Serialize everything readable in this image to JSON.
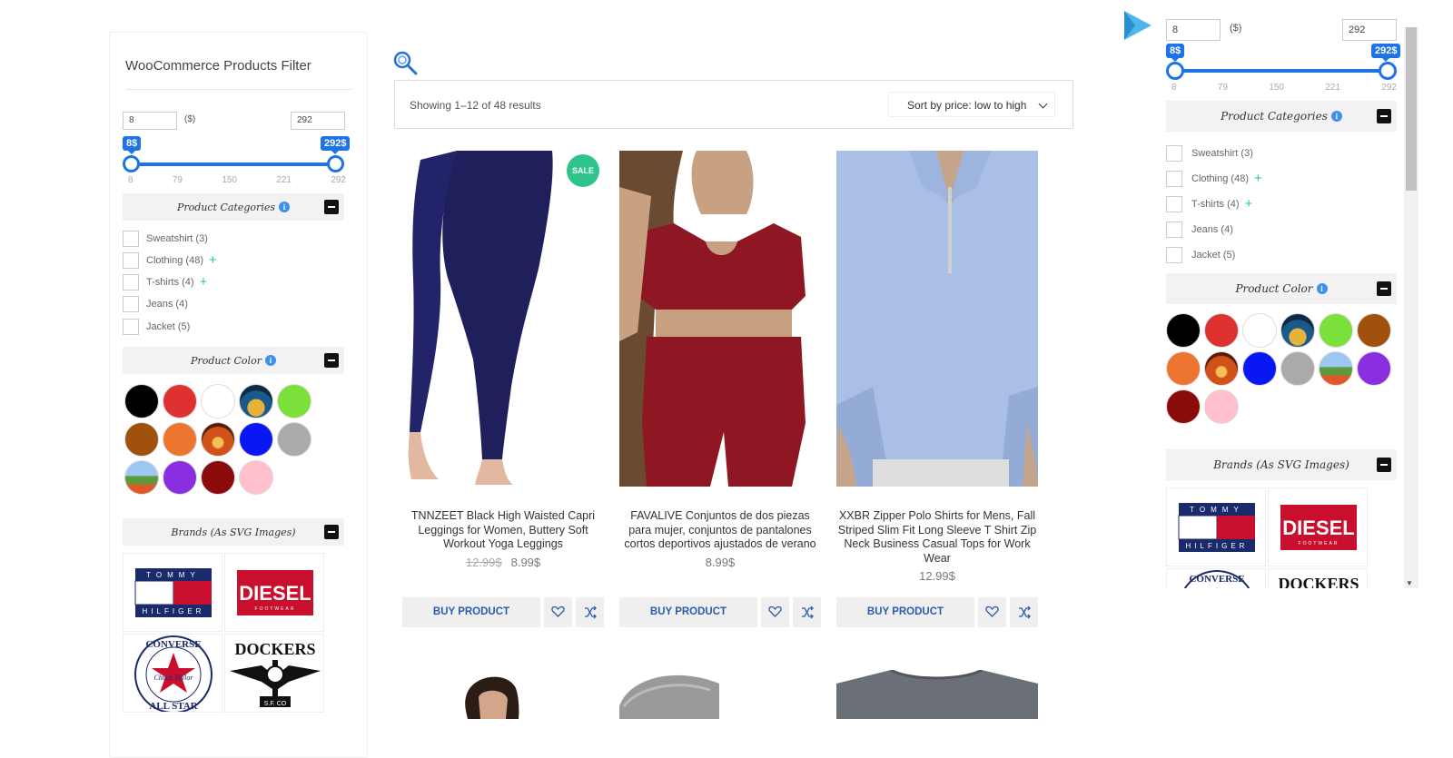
{
  "filter_widget": {
    "title": "WooCommerce Products Filter",
    "price": {
      "min_value": "8",
      "max_value": "292",
      "currency_label": "($)",
      "min_bubble": "8$",
      "max_bubble": "292$",
      "ticks": [
        "8",
        "79",
        "150",
        "221",
        "292"
      ]
    },
    "categories_header": "Product Categories",
    "categories": [
      {
        "label": "Sweatshirt (3)",
        "expandable": false
      },
      {
        "label": "Clothing (48)",
        "expandable": true
      },
      {
        "label": "T-shirts (4)",
        "expandable": true
      },
      {
        "label": "Jeans (4)",
        "expandable": false
      },
      {
        "label": "Jacket (5)",
        "expandable": false
      }
    ],
    "color_header": "Product Color",
    "colors_left": [
      "#000000",
      "#e03131",
      "#ffffff",
      "image-beach",
      "#7be03a",
      "#a0520c",
      "#ee7530",
      "image-autumn",
      "#0a17f5",
      "#aaaaaa",
      "image-flowers",
      "#8a2fe0",
      "#8b0a0a",
      "#ffc0cb"
    ],
    "colors_right": [
      "#000000",
      "#e03131",
      "#ffffff",
      "image-beach",
      "#7be03a",
      "#a0520c",
      "#ee7530",
      "image-autumn",
      "#0a17f5",
      "#aaaaaa",
      "image-flowers",
      "#8a2fe0",
      "#8b0a0a",
      "#ffc0cb"
    ],
    "brands_header": "Brands (As SVG Images)",
    "brands": [
      "TOMMY HILFIGER",
      "DIESEL",
      "CONVERSE ALL STAR",
      "DOCKERS"
    ],
    "brand_texts": {
      "tommy_top": "TOMMY",
      "tommy_bottom": "HILFIGER",
      "diesel": "DIESEL",
      "diesel_sub": "FOOTWEAR",
      "converse_top": "CONVERSE",
      "converse_mid": "Chuck Taylor",
      "converse_bottom": "ALL STAR",
      "dockers": "DOCKERS",
      "dockers_sub": "S.F. CO"
    }
  },
  "results": {
    "count_text": "Showing 1–12 of 48 results",
    "sort_label": "Sort by price: low to high"
  },
  "products": [
    {
      "name": "TNNZEET Black High Waisted Capri Leggings for Women, Buttery Soft Workout Yoga Leggings",
      "old_price": "12.99$",
      "price": "8.99$",
      "badge": "SALE",
      "button": "BUY PRODUCT"
    },
    {
      "name": "FAVALIVE Conjuntos de dos piezas para mujer, conjuntos de pantalones cortos deportivos ajustados de verano",
      "price": "8.99$",
      "button": "BUY PRODUCT"
    },
    {
      "name": "XXBR Zipper Polo Shirts for Mens, Fall Striped Slim Fit Long Sleeve T Shirt Zip Neck Business Casual Tops for Work Wear",
      "price": "12.99$",
      "button": "BUY PRODUCT"
    }
  ],
  "colors": {
    "accent": "#1e73e8",
    "sale": "#2fc48a",
    "button_text": "#2b5bb0",
    "plus": "#2ec98e"
  }
}
